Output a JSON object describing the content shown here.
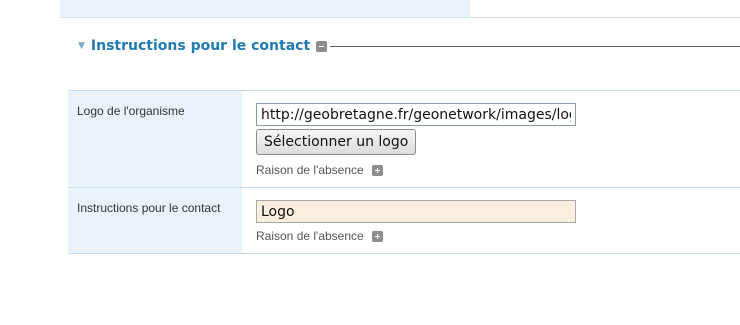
{
  "section": {
    "title": "Instructions pour le contact"
  },
  "rows": [
    {
      "label": "Logo de l'organisme",
      "input_value": "http://geobretagne.fr/geonetwork/images/logos/",
      "button_label": "Sélectionner un logo",
      "absence_label": "Raison de l'absence"
    },
    {
      "label": "Instructions pour le contact",
      "input_value": "Logo",
      "absence_label": "Raison de l'absence"
    }
  ],
  "colors": {
    "section_title": "#1f7ab0",
    "label_background": "#eaf3f9",
    "row_border": "#c3dceb",
    "filled_input_background": "#faeee0"
  },
  "icons": {
    "collapse": "triangle-down-icon",
    "section_toggle": "minus-box-icon",
    "absence_toggle": "plus-box-icon"
  }
}
